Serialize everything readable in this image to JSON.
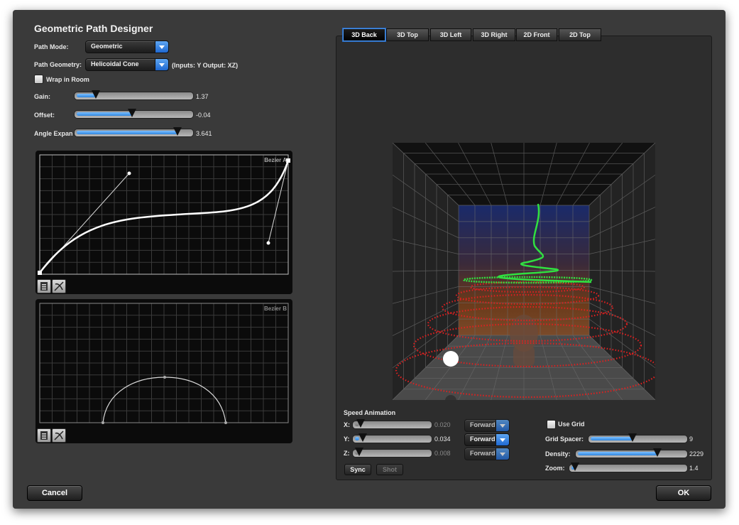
{
  "window": {
    "title": "Geometric Path Designer"
  },
  "path_mode": {
    "label": "Path Mode:",
    "value": "Geometric"
  },
  "path_geometry": {
    "label": "Path Geometry:",
    "value": "Helicoidal Cone",
    "note": "(Inputs: Y Output: XZ)"
  },
  "wrap": {
    "label": "Wrap in Room",
    "checked": false
  },
  "sliders": [
    {
      "label": "Gain:",
      "value": "1.37",
      "level": 0.17
    },
    {
      "label": "Offset:",
      "value": "-0.04",
      "level": 0.49
    },
    {
      "label": "Angle Expan",
      "value": "3.641",
      "level": 0.89
    }
  ],
  "bezier_a": {
    "label": "Bezier A"
  },
  "bezier_b": {
    "label": "Bezier B"
  },
  "tabs": [
    {
      "label": "3D Back",
      "active": true
    },
    {
      "label": "3D Top",
      "active": false
    },
    {
      "label": "3D Left",
      "active": false
    },
    {
      "label": "3D Right",
      "active": false
    },
    {
      "label": "2D Front",
      "active": false
    },
    {
      "label": "2D Top",
      "active": false
    }
  ],
  "speed": {
    "title": "Speed Animation",
    "rows": [
      {
        "axis": "X:",
        "value": "0.020",
        "direction": "Forward",
        "dim": true,
        "level": 0.03
      },
      {
        "axis": "Y:",
        "value": "0.034",
        "direction": "Forward",
        "dim": false,
        "level": 0.06
      },
      {
        "axis": "Z:",
        "value": "0.008",
        "direction": "Forward",
        "dim": true,
        "level": 0.01
      }
    ],
    "sync": "Sync",
    "shot": "Shot"
  },
  "grid": {
    "use_grid": "Use Grid",
    "rows": [
      {
        "label": "Grid Spacer:",
        "value": "9",
        "level": 0.44
      },
      {
        "label": "Density:",
        "value": "2229",
        "level": 0.74
      },
      {
        "label": "Zoom:",
        "value": "1.4",
        "level": 0.03
      }
    ]
  },
  "buttons": {
    "cancel": "Cancel",
    "ok": "OK"
  },
  "icons": {
    "bezier_doc": "clipboard-icon",
    "bezier_curve": "curve-tool-icon"
  }
}
